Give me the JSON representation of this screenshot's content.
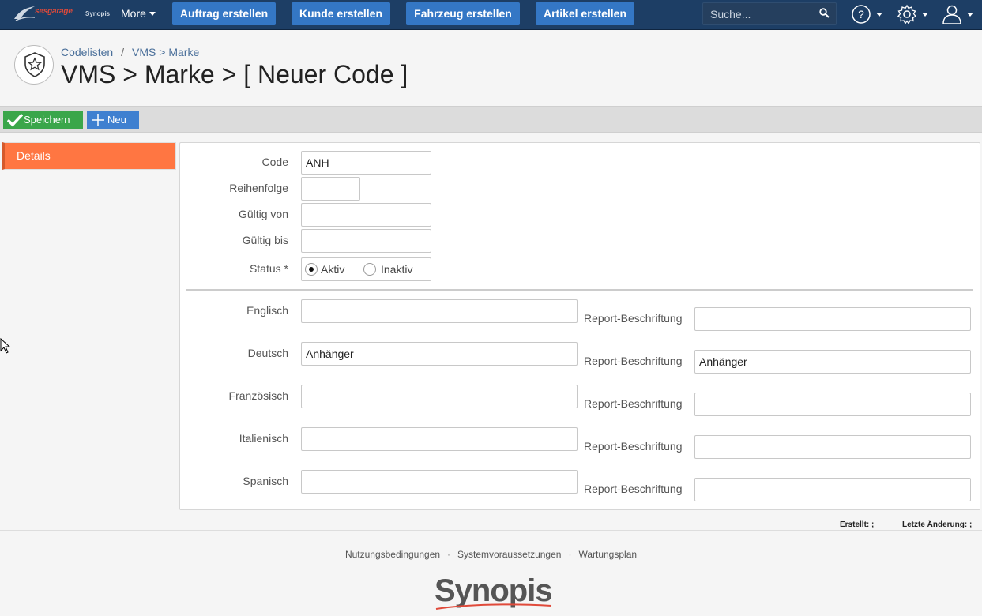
{
  "app": {
    "brand": "sesgarage",
    "sub_brand": "Synopis"
  },
  "navbar": {
    "more_label": "More",
    "buttons": [
      {
        "label": "Auftrag erstellen"
      },
      {
        "label": "Kunde erstellen"
      },
      {
        "label": "Fahrzeug erstellen"
      },
      {
        "label": "Artikel erstellen"
      }
    ],
    "search_placeholder": "Suche..."
  },
  "header": {
    "breadcrumb": [
      "Codelisten",
      "VMS > Marke"
    ],
    "title": "VMS > Marke > [ Neuer Code ]"
  },
  "toolbar": {
    "save_label": "Speichern",
    "new_label": "Neu"
  },
  "sidebar": {
    "tabs": [
      {
        "label": "Details"
      }
    ]
  },
  "form": {
    "code_label": "Code",
    "code_value": "ANH",
    "order_label": "Reihenfolge",
    "order_value": "",
    "valid_from_label": "Gültig von",
    "valid_from_value": "",
    "valid_to_label": "Gültig bis",
    "valid_to_value": "",
    "status_label": "Status",
    "status_required": "*",
    "status_options": [
      {
        "label": "Aktiv",
        "checked": true
      },
      {
        "label": "Inaktiv",
        "checked": false
      }
    ],
    "report_label": "Report-Beschriftung",
    "languages": [
      {
        "label": "Englisch",
        "value": "",
        "report": ""
      },
      {
        "label": "Deutsch",
        "value": "Anhänger",
        "report": "Anhänger"
      },
      {
        "label": "Französisch",
        "value": "",
        "report": ""
      },
      {
        "label": "Italienisch",
        "value": "",
        "report": ""
      },
      {
        "label": "Spanisch",
        "value": "",
        "report": ""
      }
    ]
  },
  "meta": {
    "created_label": "Erstellt:",
    "created_value": ";",
    "modified_label": "Letzte Änderung:",
    "modified_value": ";"
  },
  "footer": {
    "links": [
      "Nutzungsbedingungen",
      "Systemvoraussetzungen",
      "Wartungsplan"
    ],
    "logo_text": "Synopis"
  },
  "colors": {
    "navbar_bg": "#1d3e65",
    "nav_button": "#3477c5",
    "save_button": "#3aa64a",
    "new_button": "#3f80d0",
    "active_tab": "#ff7642"
  }
}
